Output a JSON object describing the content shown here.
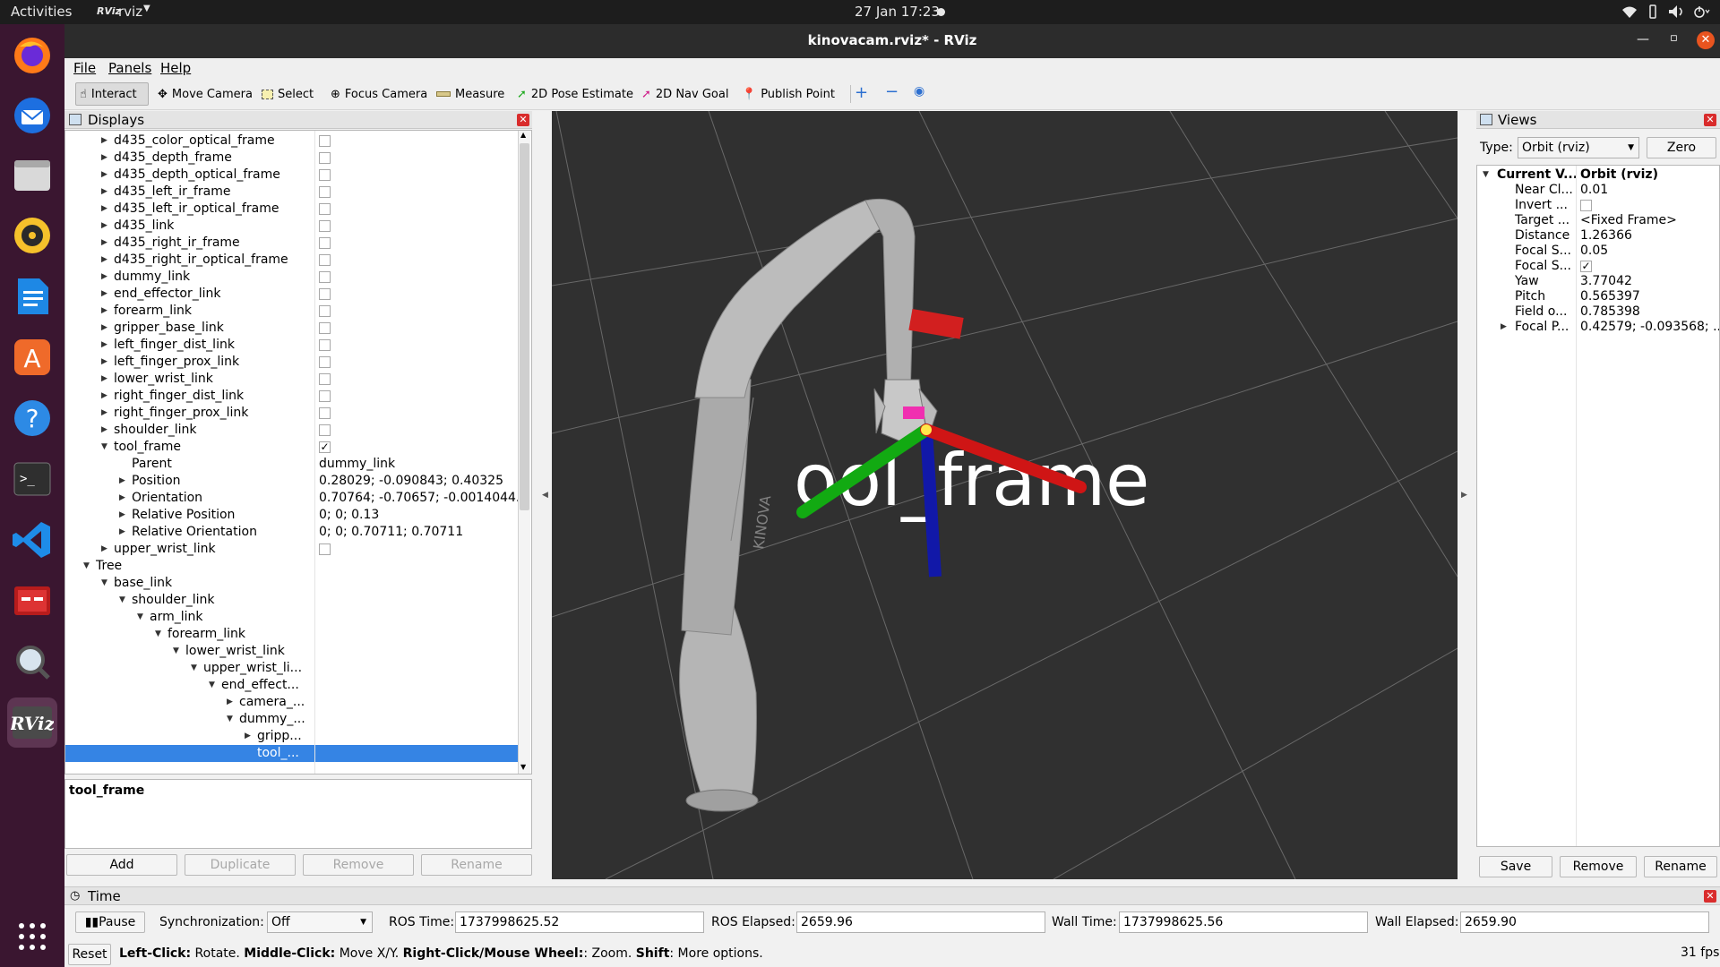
{
  "topbar": {
    "activities": "Activities",
    "app": "rviz",
    "clock": "27 Jan  17:23"
  },
  "window": {
    "title": "kinovacam.rviz* - RViz"
  },
  "menu": {
    "file": "File",
    "panels": "Panels",
    "help": "Help"
  },
  "toolbar": {
    "interact": "Interact",
    "move_camera": "Move Camera",
    "select": "Select",
    "focus_camera": "Focus Camera",
    "measure": "Measure",
    "pose_estimate": "2D Pose Estimate",
    "nav_goal": "2D Nav Goal",
    "publish_point": "Publish Point"
  },
  "displays": {
    "title": "Displays",
    "rows": [
      {
        "label": "d435_color_optical_frame",
        "indent": 2,
        "arrow": "collapsed",
        "check": false
      },
      {
        "label": "d435_depth_frame",
        "indent": 2,
        "arrow": "collapsed",
        "check": false
      },
      {
        "label": "d435_depth_optical_frame",
        "indent": 2,
        "arrow": "collapsed",
        "check": false
      },
      {
        "label": "d435_left_ir_frame",
        "indent": 2,
        "arrow": "collapsed",
        "check": false
      },
      {
        "label": "d435_left_ir_optical_frame",
        "indent": 2,
        "arrow": "collapsed",
        "check": false
      },
      {
        "label": "d435_link",
        "indent": 2,
        "arrow": "collapsed",
        "check": false
      },
      {
        "label": "d435_right_ir_frame",
        "indent": 2,
        "arrow": "collapsed",
        "check": false
      },
      {
        "label": "d435_right_ir_optical_frame",
        "indent": 2,
        "arrow": "collapsed",
        "check": false
      },
      {
        "label": "dummy_link",
        "indent": 2,
        "arrow": "collapsed",
        "check": false
      },
      {
        "label": "end_effector_link",
        "indent": 2,
        "arrow": "collapsed",
        "check": false
      },
      {
        "label": "forearm_link",
        "indent": 2,
        "arrow": "collapsed",
        "check": false
      },
      {
        "label": "gripper_base_link",
        "indent": 2,
        "arrow": "collapsed",
        "check": false
      },
      {
        "label": "left_finger_dist_link",
        "indent": 2,
        "arrow": "collapsed",
        "check": false
      },
      {
        "label": "left_finger_prox_link",
        "indent": 2,
        "arrow": "collapsed",
        "check": false
      },
      {
        "label": "lower_wrist_link",
        "indent": 2,
        "arrow": "collapsed",
        "check": false
      },
      {
        "label": "right_finger_dist_link",
        "indent": 2,
        "arrow": "collapsed",
        "check": false
      },
      {
        "label": "right_finger_prox_link",
        "indent": 2,
        "arrow": "collapsed",
        "check": false
      },
      {
        "label": "shoulder_link",
        "indent": 2,
        "arrow": "collapsed",
        "check": false
      },
      {
        "label": "tool_frame",
        "indent": 2,
        "arrow": "expanded",
        "check": true
      },
      {
        "label": "Parent",
        "indent": 3,
        "arrow": "none",
        "value": "dummy_link"
      },
      {
        "label": "Position",
        "indent": 3,
        "arrow": "collapsed",
        "value": "0.28029; -0.090843; 0.40325"
      },
      {
        "label": "Orientation",
        "indent": 3,
        "arrow": "collapsed",
        "value": "0.70764; -0.70657; -0.0014044..."
      },
      {
        "label": "Relative Position",
        "indent": 3,
        "arrow": "collapsed",
        "value": "0; 0; 0.13"
      },
      {
        "label": "Relative Orientation",
        "indent": 3,
        "arrow": "collapsed",
        "value": "0; 0; 0.70711; 0.70711"
      },
      {
        "label": "upper_wrist_link",
        "indent": 2,
        "arrow": "collapsed",
        "check": false
      },
      {
        "label": "Tree",
        "indent": 1,
        "arrow": "expanded"
      },
      {
        "label": "base_link",
        "indent": 2,
        "arrow": "expanded"
      },
      {
        "label": "shoulder_link",
        "indent": 3,
        "arrow": "expanded"
      },
      {
        "label": "arm_link",
        "indent": 4,
        "arrow": "expanded"
      },
      {
        "label": "forearm_link",
        "indent": 5,
        "arrow": "expanded"
      },
      {
        "label": "lower_wrist_link",
        "indent": 6,
        "arrow": "expanded"
      },
      {
        "label": "upper_wrist_li...",
        "indent": 7,
        "arrow": "expanded"
      },
      {
        "label": "end_effect...",
        "indent": 8,
        "arrow": "expanded"
      },
      {
        "label": "camera_...",
        "indent": 9,
        "arrow": "collapsed"
      },
      {
        "label": "dummy_...",
        "indent": 9,
        "arrow": "expanded"
      },
      {
        "label": "gripp...",
        "indent": 10,
        "arrow": "collapsed"
      },
      {
        "label": "tool_...",
        "indent": 10,
        "arrow": "none",
        "selected": true
      }
    ],
    "description": "tool_frame",
    "add": "Add",
    "duplicate": "Duplicate",
    "remove": "Remove",
    "rename": "Rename"
  },
  "viewport": {
    "overlay_text": "ool_frame",
    "brand_text": "KINOVA"
  },
  "views": {
    "title": "Views",
    "type_label": "Type:",
    "type_value": "Orbit (rviz)",
    "zero": "Zero",
    "rows": [
      {
        "label": "Current V...",
        "value": "Orbit (rviz)",
        "bold": true,
        "arrow": "expanded",
        "indent": 0
      },
      {
        "label": "Near Cl...",
        "value": "0.01",
        "indent": 1
      },
      {
        "label": "Invert ...",
        "check": false,
        "indent": 1
      },
      {
        "label": "Target ...",
        "value": "<Fixed Frame>",
        "indent": 1
      },
      {
        "label": "Distance",
        "value": "1.26366",
        "indent": 1
      },
      {
        "label": "Focal S...",
        "value": "0.05",
        "indent": 1
      },
      {
        "label": "Focal S...",
        "check": true,
        "indent": 1
      },
      {
        "label": "Yaw",
        "value": "3.77042",
        "indent": 1
      },
      {
        "label": "Pitch",
        "value": "0.565397",
        "indent": 1
      },
      {
        "label": "Field o...",
        "value": "0.785398",
        "indent": 1
      },
      {
        "label": "Focal P...",
        "value": "0.42579; -0.093568; ...",
        "indent": 1,
        "arrow": "collapsed"
      }
    ],
    "save": "Save",
    "remove": "Remove",
    "rename": "Rename"
  },
  "time": {
    "title": "Time",
    "pause": "Pause",
    "sync_label": "Synchronization:",
    "sync_value": "Off",
    "ros_time_label": "ROS Time:",
    "ros_time": "1737998625.52",
    "ros_elapsed_label": "ROS Elapsed:",
    "ros_elapsed": "2659.96",
    "wall_time_label": "Wall Time:",
    "wall_time": "1737998625.56",
    "wall_elapsed_label": "Wall Elapsed:",
    "wall_elapsed": "2659.90"
  },
  "status": {
    "reset": "Reset",
    "left_click": "Left-Click:",
    "left_click_desc": " Rotate. ",
    "middle_click": "Middle-Click:",
    "middle_click_desc": " Move X/Y. ",
    "right_click": "Right-Click/Mouse Wheel:",
    "right_click_desc": ": Zoom. ",
    "shift": "Shift",
    "shift_desc": ": More options.",
    "fps": "31 fps"
  }
}
